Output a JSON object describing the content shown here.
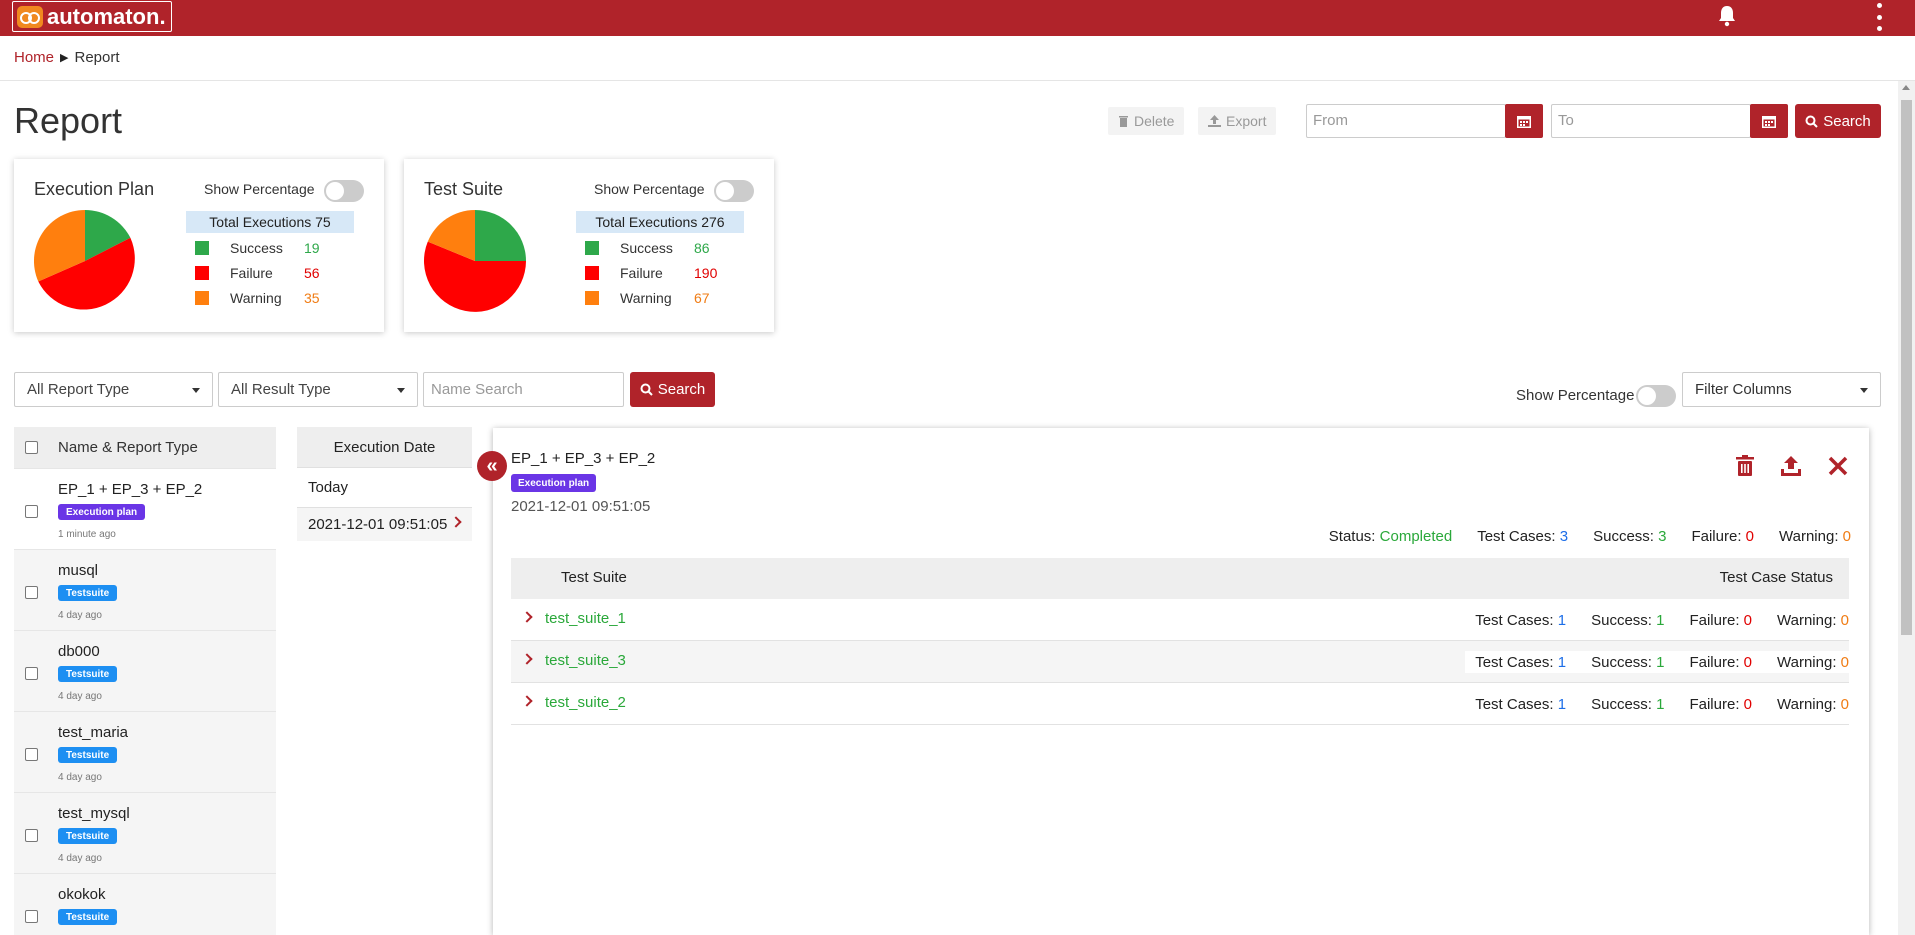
{
  "app": {
    "name": "automaton."
  },
  "breadcrumb": {
    "home": "Home",
    "current": "Report"
  },
  "page": {
    "title": "Report"
  },
  "toolbar": {
    "delete_label": "Delete",
    "export_label": "Export",
    "from_placeholder": "From",
    "to_placeholder": "To",
    "search_label": "Search"
  },
  "cards": {
    "execution_plan": {
      "title": "Execution Plan",
      "toggle_label": "Show Percentage",
      "total_label": "Total Executions 75",
      "success_label": "Success",
      "success_value": "19",
      "failure_label": "Failure",
      "failure_value": "56",
      "warning_label": "Warning",
      "warning_value": "35"
    },
    "test_suite": {
      "title": "Test Suite",
      "toggle_label": "Show Percentage",
      "total_label": "Total Executions 276",
      "success_label": "Success",
      "success_value": "86",
      "failure_label": "Failure",
      "failure_value": "190",
      "warning_label": "Warning",
      "warning_value": "67"
    }
  },
  "colors": {
    "brand": "#b0232a",
    "success": "#2aa83a",
    "failure": "#ff0000",
    "warning": "#ff7f0e",
    "plan_badge": "#6a35e6",
    "suite_badge": "#1d8ff2"
  },
  "filters": {
    "report_type": "All Report Type",
    "result_type": "All Result Type",
    "name_search_placeholder": "Name Search",
    "search_label": "Search",
    "show_percentage": "Show Percentage",
    "filter_columns": "Filter Columns"
  },
  "list": {
    "header": "Name & Report Type",
    "items": [
      {
        "name": "EP_1 + EP_3 + EP_2",
        "type": "Execution plan",
        "ago": "1 minute ago"
      },
      {
        "name": "musql",
        "type": "Testsuite",
        "ago": "4 day ago"
      },
      {
        "name": "db000",
        "type": "Testsuite",
        "ago": "4 day ago"
      },
      {
        "name": "test_maria",
        "type": "Testsuite",
        "ago": "4 day ago"
      },
      {
        "name": "test_mysql",
        "type": "Testsuite",
        "ago": "4 day ago"
      },
      {
        "name": "okokok",
        "type": "Testsuite",
        "ago": ""
      }
    ]
  },
  "execution": {
    "header": "Execution Date",
    "group": "Today",
    "item": "2021-12-01 09:51:05"
  },
  "detail": {
    "title": "EP_1 + EP_3 + EP_2",
    "badge": "Execution plan",
    "date": "2021-12-01 09:51:05",
    "status_label": "Status:",
    "status_value": "Completed",
    "test_cases_label": "Test Cases:",
    "test_cases_value": "3",
    "success_label": "Success:",
    "success_value": "3",
    "failure_label": "Failure:",
    "failure_value": "0",
    "warning_label": "Warning:",
    "warning_value": "0",
    "col_suite": "Test Suite",
    "col_status": "Test Case Status",
    "rows": [
      {
        "name": "test_suite_1",
        "tc": "1",
        "success": "1",
        "failure": "0",
        "warning": "0"
      },
      {
        "name": "test_suite_3",
        "tc": "1",
        "success": "1",
        "failure": "0",
        "warning": "0"
      },
      {
        "name": "test_suite_2",
        "tc": "1",
        "success": "1",
        "failure": "0",
        "warning": "0"
      }
    ],
    "row_labels": {
      "tc": "Test Cases:",
      "success": "Success:",
      "failure": "Failure:",
      "warning": "Warning:"
    }
  }
}
